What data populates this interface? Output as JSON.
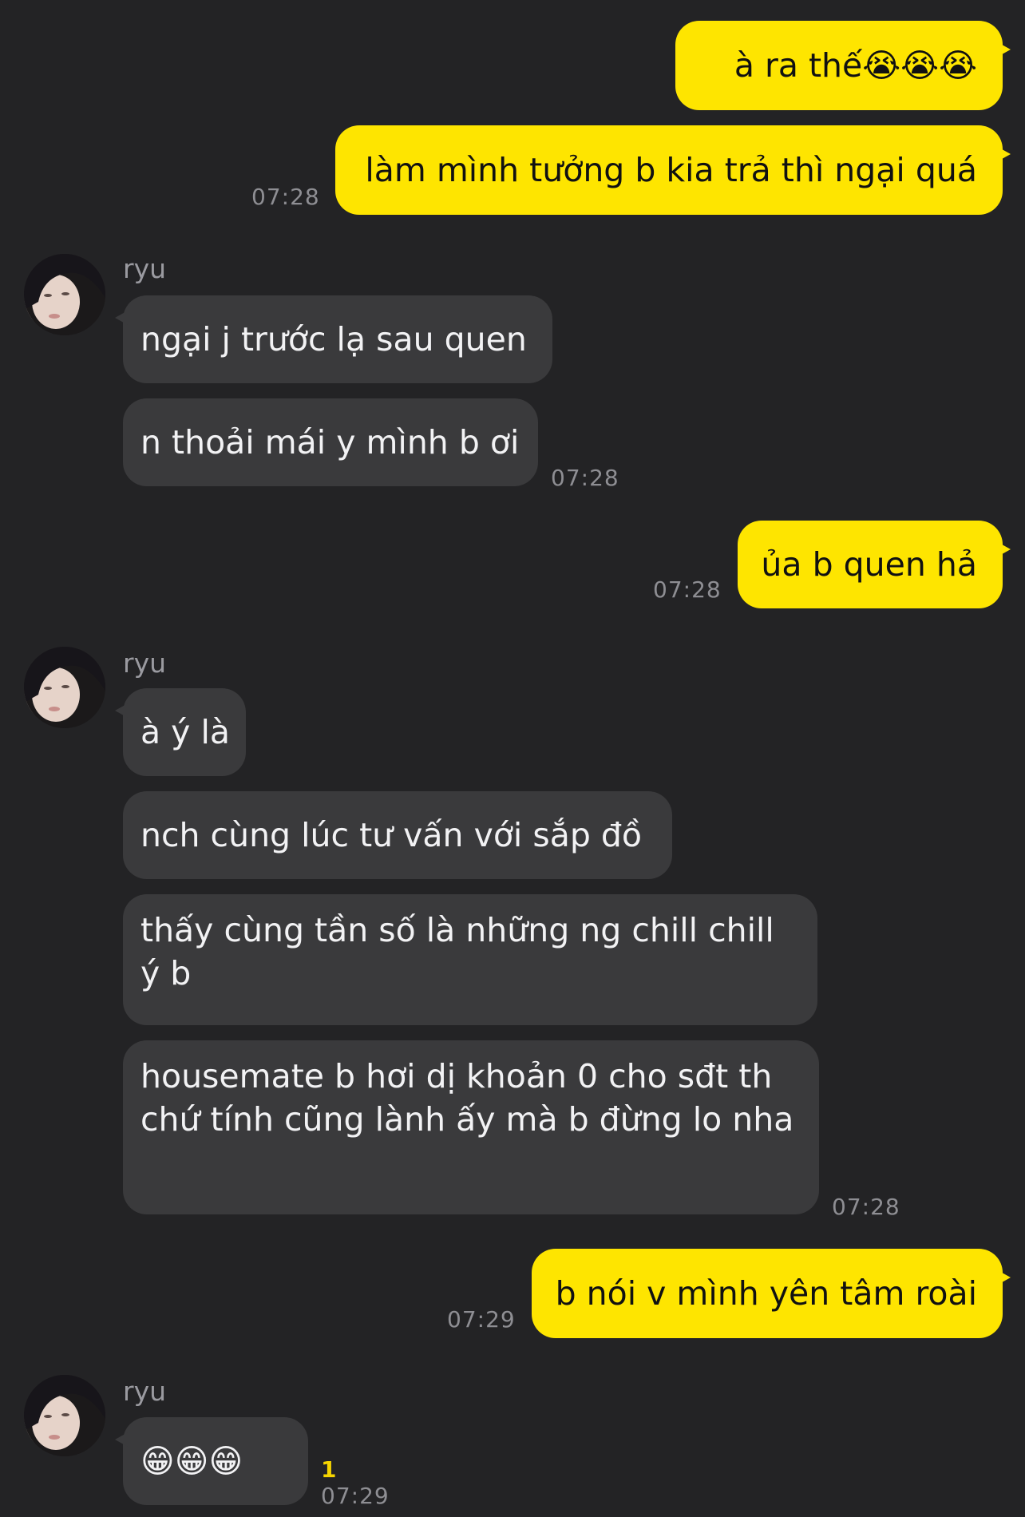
{
  "theme": {
    "background": "#232325",
    "my_bubble": "#FEE500",
    "their_bubble": "#3A3A3C",
    "timestamp": "#8E8E93",
    "unread": "#F5D400"
  },
  "messages": {
    "m1": {
      "text": "à ra thế😭😭😭"
    },
    "m2": {
      "text": "làm mình tưởng b kia trả thì ngại quá",
      "time": "07:28"
    },
    "g1": {
      "sender": "ryu",
      "b1": "ngại j trước lạ sau quen",
      "b2": "n thoải mái y mình b ơi",
      "time": "07:28"
    },
    "m3": {
      "text": "ủa b quen hả",
      "time": "07:28"
    },
    "g2": {
      "sender": "ryu",
      "b1": "à ý là",
      "b2": "nch cùng lúc tư vấn với sắp đồ",
      "b3": "thấy cùng tần số là những ng chill chill ý b",
      "b4": "housemate b hơi dị khoản 0 cho sđt th chứ tính cũng lành ấy mà b đừng lo nha",
      "time": "07:28"
    },
    "m4": {
      "text": "b nói v mình yên tâm roài",
      "time": "07:29"
    },
    "g3": {
      "sender": "ryu",
      "b1": "😁😁😁",
      "unread": "1",
      "time": "07:29"
    }
  },
  "icons": {
    "avatar": "profile-photo"
  }
}
